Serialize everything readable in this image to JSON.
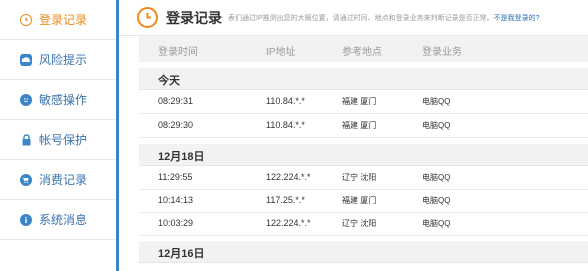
{
  "sidebar": {
    "items": [
      {
        "label": "登录记录",
        "icon": "clock-icon",
        "active": true
      },
      {
        "label": "风险提示",
        "icon": "cloud-icon"
      },
      {
        "label": "敏感操作",
        "icon": "face-icon"
      },
      {
        "label": "帐号保护",
        "icon": "lock-icon"
      },
      {
        "label": "消费记录",
        "icon": "cart-icon"
      },
      {
        "label": "系统消息",
        "icon": "info-icon"
      }
    ]
  },
  "header": {
    "title": "登录记录",
    "description": "表们通过IP推测出您的大概位置，请通过时间、地点和登录业务来判断记录是否正常。",
    "link": "不是我登录的?"
  },
  "table": {
    "columns": [
      "登录时间",
      "IP地址",
      "参考地点",
      "登录业务"
    ],
    "groups": [
      {
        "date": "今天",
        "rows": [
          {
            "time": "08:29:31",
            "ip": "110.84.*.*",
            "location": "福建 厦门",
            "service": "电脑QQ"
          },
          {
            "time": "08:29:30",
            "ip": "110.84.*.*",
            "location": "福建 厦门",
            "service": "电脑QQ"
          }
        ]
      },
      {
        "date": "12月18日",
        "rows": [
          {
            "time": "11:29:55",
            "ip": "122.224.*.*",
            "location": "辽宁 沈阳",
            "service": "电脑QQ"
          },
          {
            "time": "10:14:13",
            "ip": "117.25.*.*",
            "location": "福建 厦门",
            "service": "电脑QQ"
          },
          {
            "time": "10:03:29",
            "ip": "122.224.*.*",
            "location": "辽宁 沈阳",
            "service": "电脑QQ"
          }
        ]
      },
      {
        "date": "12月16日",
        "rows": []
      }
    ]
  },
  "colors": {
    "accent_orange": "#ee8a1a",
    "accent_blue": "#3a86c8",
    "link_blue": "#2a6ebb"
  }
}
